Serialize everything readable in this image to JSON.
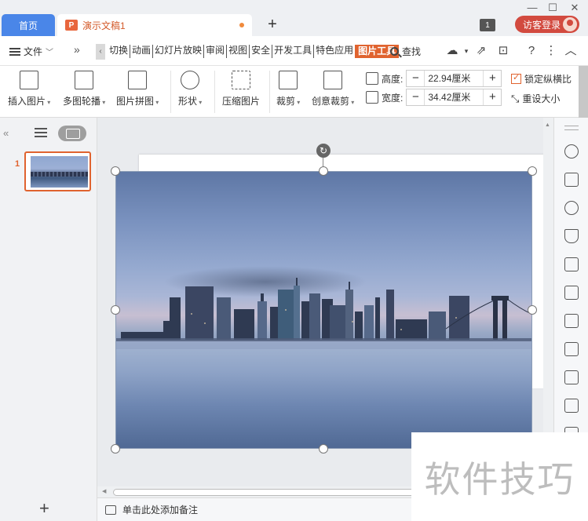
{
  "titlebar": {
    "home_tab": "首页",
    "doc_tab": "演示文稿1",
    "doc_icon_letter": "P",
    "window_badge": "1",
    "login_label": "访客登录",
    "new_tab_symbol": "+"
  },
  "menubar": {
    "file_label": "文件",
    "more_symbol": "»",
    "tabs": [
      "切换",
      "动画",
      "幻灯片放映",
      "审阅",
      "视图",
      "安全",
      "开发工具",
      "特色应用",
      "图片工具"
    ],
    "active_tab": "图片工具",
    "search_label": "查找"
  },
  "ribbon": {
    "insert_picture": "插入图片",
    "multi_carousel": "多图轮播",
    "picture_collage": "图片拼图",
    "shape": "形状",
    "compress_picture": "压缩图片",
    "crop": "裁剪",
    "creative_crop": "创意裁剪",
    "height_label": "高度:",
    "height_value": "22.94厘米",
    "width_label": "宽度:",
    "width_value": "34.42厘米",
    "lock_ratio_label": "锁定纵横比",
    "lock_ratio_checked": true,
    "reset_size_label": "重设大小",
    "minus_symbol": "−",
    "plus_symbol": "+"
  },
  "leftpanel": {
    "collapse_symbol": "«",
    "slide_number": "1",
    "add_symbol": "+"
  },
  "statusbar": {
    "note_placeholder": "单击此处添加备注"
  },
  "watermark": {
    "text": "软件技巧"
  },
  "colors": {
    "accent": "#e0632f",
    "home_tab": "#4a86e8",
    "login_button": "#d24a3f"
  }
}
